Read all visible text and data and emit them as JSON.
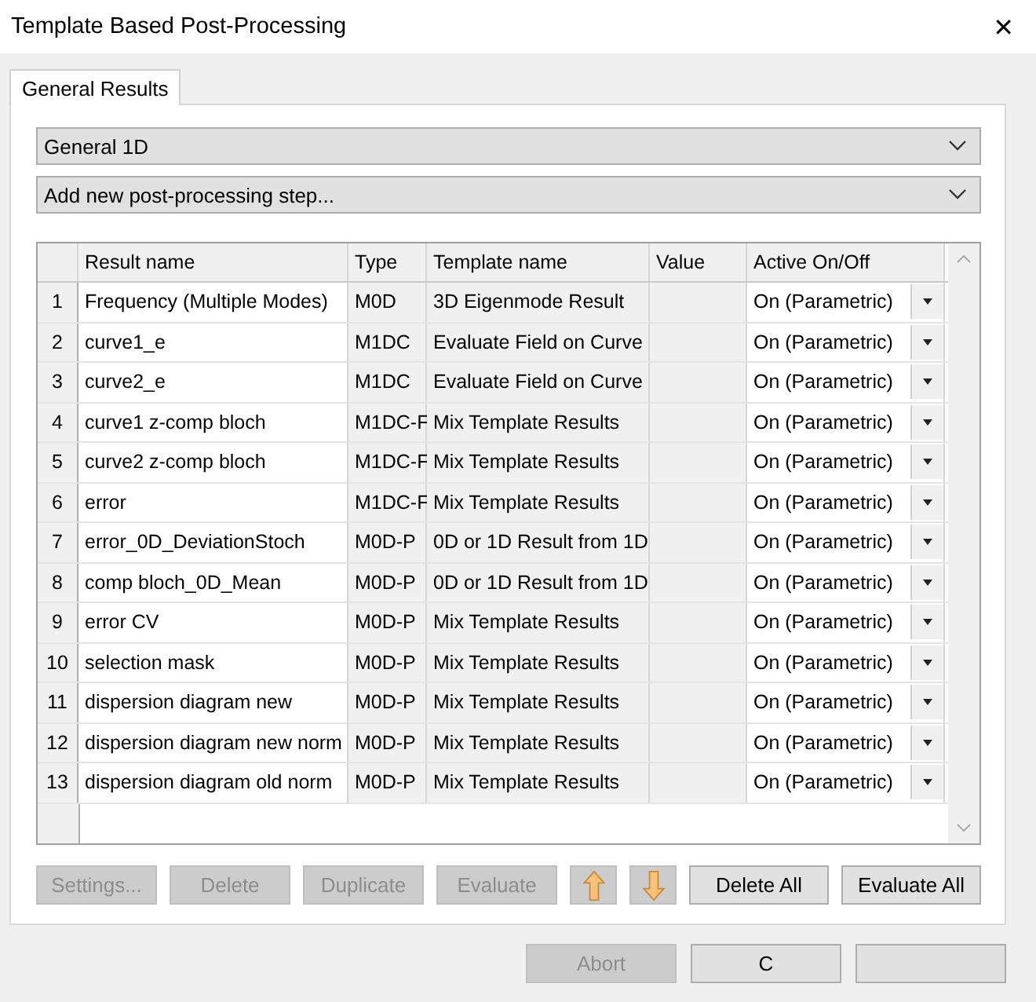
{
  "window": {
    "title": "Template Based Post-Processing",
    "close": "✕"
  },
  "tabs": [
    {
      "label": "General Results",
      "selected": true
    }
  ],
  "category_dropdown": {
    "value": "General 1D"
  },
  "step_dropdown": {
    "value": "Add new post-processing step..."
  },
  "table": {
    "columns": [
      "Result name",
      "Type",
      "Template name",
      "Value",
      "Active On/Off"
    ],
    "rows": [
      {
        "index": "1",
        "name": "Frequency (Multiple Modes)",
        "type": "M0D",
        "template": "3D Eigenmode Result",
        "active": "On (Parametric)"
      },
      {
        "index": "2",
        "name": "curve1_e",
        "type": "M1DC",
        "template": "Evaluate Field on Curve",
        "active": "On (Parametric)"
      },
      {
        "index": "3",
        "name": "curve2_e",
        "type": "M1DC",
        "template": "Evaluate Field on Curve",
        "active": "On (Parametric)"
      },
      {
        "index": "4",
        "name": "curve1 z-comp bloch",
        "type": "M1DC-F",
        "template": "Mix Template Results",
        "active": "On (Parametric)"
      },
      {
        "index": "5",
        "name": "curve2 z-comp bloch",
        "type": "M1DC-F",
        "template": "Mix Template Results",
        "active": "On (Parametric)"
      },
      {
        "index": "6",
        "name": "error",
        "type": "M1DC-F",
        "template": "Mix Template Results",
        "active": "On (Parametric)"
      },
      {
        "index": "7",
        "name": "error_0D_DeviationStoch",
        "type": "M0D-P",
        "template": "0D or 1D Result from 1D",
        "active": "On (Parametric)"
      },
      {
        "index": "8",
        "name": "comp bloch_0D_Mean",
        "type": "M0D-P",
        "template": "0D or 1D Result from 1D",
        "active": "On (Parametric)"
      },
      {
        "index": "9",
        "name": "error CV",
        "type": "M0D-P",
        "template": "Mix Template Results",
        "active": "On (Parametric)"
      },
      {
        "index": "10",
        "name": "selection mask",
        "type": "M0D-P",
        "template": "Mix Template Results",
        "active": "On (Parametric)"
      },
      {
        "index": "11",
        "name": "dispersion diagram new",
        "type": "M0D-P",
        "template": "Mix Template Results",
        "active": "On (Parametric)"
      },
      {
        "index": "12",
        "name": "dispersion diagram new norm",
        "type": "M0D-P",
        "template": "Mix Template Results",
        "active": "On (Parametric)"
      },
      {
        "index": "13",
        "name": "dispersion diagram old norm",
        "type": "M0D-P",
        "template": "Mix Template Results",
        "active": "On (Parametric)"
      }
    ]
  },
  "actions": [
    {
      "kind": "text",
      "label": "Settings...",
      "disabled": true
    },
    {
      "kind": "text",
      "label": "Delete",
      "disabled": true
    },
    {
      "kind": "text",
      "label": "Duplicate",
      "disabled": true
    },
    {
      "kind": "text",
      "label": "Evaluate",
      "disabled": true
    },
    {
      "kind": "up",
      "disabled": true
    },
    {
      "kind": "down",
      "disabled": true
    },
    {
      "kind": "text",
      "label": "Delete All",
      "disabled": false
    },
    {
      "kind": "text",
      "label": "Evaluate All",
      "disabled": false
    }
  ],
  "footer_buttons": [
    {
      "label": "Abort",
      "disabled": true
    },
    {
      "label": "C",
      "disabled": false
    },
    {
      "disabled": false
    }
  ]
}
